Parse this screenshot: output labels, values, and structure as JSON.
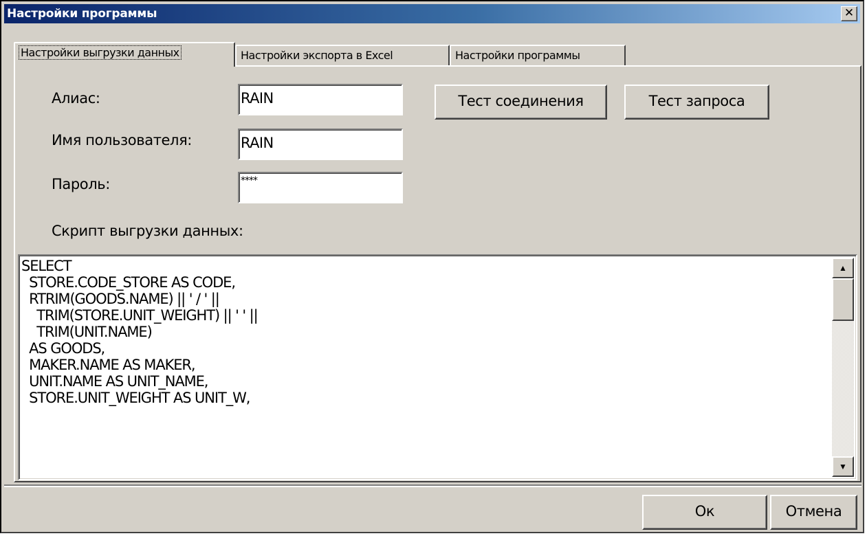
{
  "window": {
    "title": "Настройки программы",
    "close_glyph": "✕"
  },
  "tabs": [
    {
      "label": "Настройки выгрузки данных",
      "active": true
    },
    {
      "label": "Настройки экспорта в Excel",
      "active": false
    },
    {
      "label": "Настройки программы",
      "active": false
    }
  ],
  "form": {
    "alias_label": "Алиас:",
    "alias_value": "RAIN",
    "user_label": "Имя пользователя:",
    "user_value": "RAIN",
    "password_label": "Пароль:",
    "password_value": "****",
    "script_label": "Скрипт выгрузки данных:",
    "script_text": "SELECT\n  STORE.CODE_STORE AS CODE,\n  RTRIM(GOODS.NAME) || ' / ' ||\n    TRIM(STORE.UNIT_WEIGHT) || ' ' ||\n    TRIM(UNIT.NAME)\n  AS GOODS,\n  MAKER.NAME AS MAKER,\n  UNIT.NAME AS UNIT_NAME,\n  STORE.UNIT_WEIGHT AS UNIT_W,"
  },
  "buttons": {
    "test_connection": "Тест соединения",
    "test_query": "Тест запроса",
    "ok": "Ок",
    "cancel": "Отмена"
  },
  "icons": {
    "scroll_up": "▲",
    "scroll_down": "▼"
  },
  "colors": {
    "face": "#d4d0c8",
    "title_start": "#0a246a",
    "title_end": "#a6caf0"
  }
}
